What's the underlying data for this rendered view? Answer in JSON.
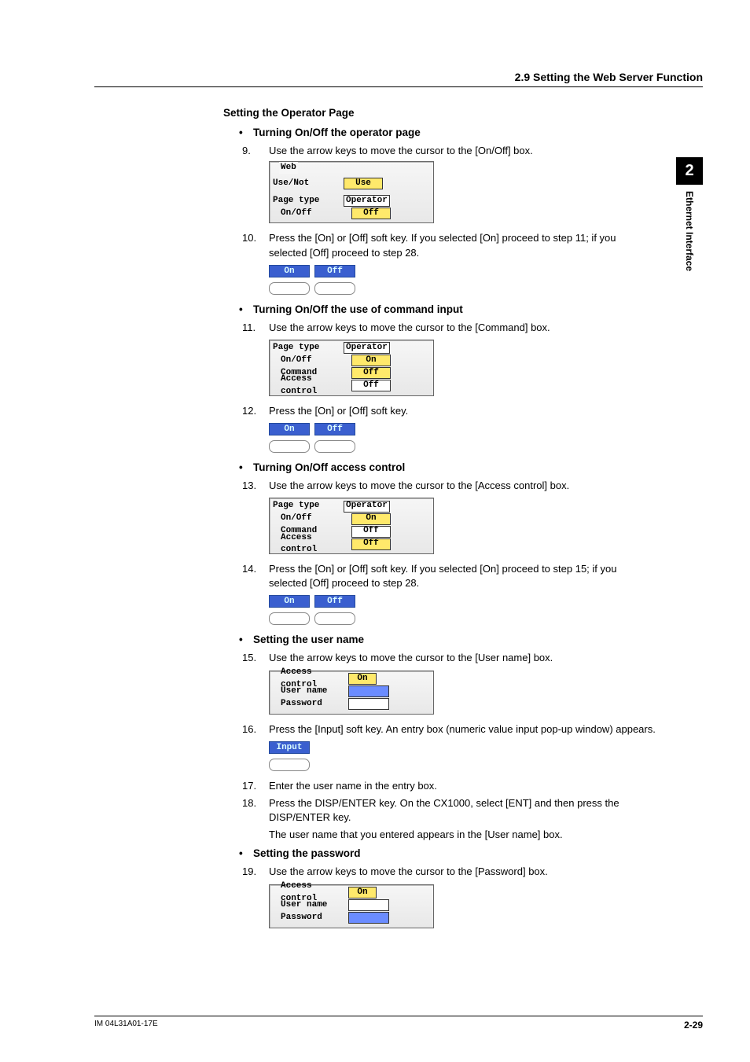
{
  "header": {
    "section": "2.9  Setting the Web Server Function"
  },
  "sidetab": {
    "chapter": "2",
    "title": "Ethernet Interface"
  },
  "heading": "Setting the Operator Page",
  "sec1": {
    "title": "Turning On/Off the operator page",
    "step9": {
      "num": "9.",
      "text": "Use the arrow keys to move the cursor to the [On/Off] box."
    },
    "panel1": {
      "legend": "Web",
      "rows": {
        "useNotLabel": "Use/Not",
        "useNotValue": "Use",
        "pageTypeLabel": "Page type",
        "pageTypeValue": "Operator",
        "onOffLabel": "On/Off",
        "onOffValue": "Off"
      }
    },
    "step10": {
      "num": "10.",
      "text": "Press the [On] or [Off] soft key.  If you selected [On] proceed to step 11; if you selected [Off] proceed to step 28."
    },
    "softkeys": {
      "on": "On",
      "off": "Off"
    }
  },
  "sec2": {
    "title": "Turning On/Off the use of command input",
    "step11": {
      "num": "11.",
      "text": "Use the arrow keys to move the cursor to the [Command] box."
    },
    "panel": {
      "pageTypeLabel": "Page type",
      "pageTypeValue": "Operator",
      "onOffLabel": "On/Off",
      "onOffValue": "On",
      "commandLabel": "Command",
      "commandValue": "Off",
      "accessLabel": "Access control",
      "accessValue": "Off"
    },
    "step12": {
      "num": "12.",
      "text": "Press the [On] or [Off] soft key."
    },
    "softkeys": {
      "on": "On",
      "off": "Off"
    }
  },
  "sec3": {
    "title": "Turning On/Off access control",
    "step13": {
      "num": "13.",
      "text": "Use the arrow keys to move the cursor to the [Access control] box."
    },
    "panel": {
      "pageTypeLabel": "Page type",
      "pageTypeValue": "Operator",
      "onOffLabel": "On/Off",
      "onOffValue": "On",
      "commandLabel": "Command",
      "commandValue": "Off",
      "accessLabel": "Access control",
      "accessValue": "Off"
    },
    "step14": {
      "num": "14.",
      "text": "Press the [On] or [Off] soft key.  If you selected [On] proceed to step 15; if you selected [Off] proceed to step 28."
    },
    "softkeys": {
      "on": "On",
      "off": "Off"
    }
  },
  "sec4": {
    "title": "Setting the user name",
    "step15": {
      "num": "15.",
      "text": "Use the arrow keys to move the cursor to the [User name] box."
    },
    "panel": {
      "accessLabel": "Access control",
      "accessValue": "On",
      "userLabel": "User name",
      "userValue": "",
      "passLabel": "Password",
      "passValue": ""
    },
    "step16": {
      "num": "16.",
      "text": "Press the [Input] soft key.   An entry box (numeric value input pop-up window) appears."
    },
    "softkey": {
      "input": "Input"
    },
    "step17": {
      "num": "17.",
      "text": "Enter the user name in the entry box."
    },
    "step18": {
      "num": "18.",
      "text": "Press the DISP/ENTER key.  On the CX1000, select [ENT] and then press the DISP/ENTER key.",
      "sub": "The user name that you entered appears in the [User name] box."
    }
  },
  "sec5": {
    "title": "Setting the password",
    "step19": {
      "num": "19.",
      "text": "Use the arrow keys to move the cursor to the [Password] box."
    },
    "panel": {
      "accessLabel": "Access control",
      "accessValue": "On",
      "userLabel": "User name",
      "userValue": "",
      "passLabel": "Password",
      "passValue": ""
    }
  },
  "footer": {
    "docid": "IM 04L31A01-17E",
    "page": "2-29"
  }
}
